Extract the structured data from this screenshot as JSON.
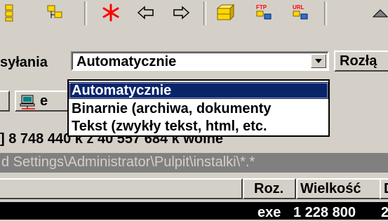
{
  "transfer": {
    "mode_label": "syłania",
    "mode_value": "Automatycznie",
    "split_button": "Rozłą",
    "options": [
      "Automatycznie",
      "Binarnie (archiwa, dokumenty",
      "Tekst (zwykły tekst, html, etc."
    ],
    "selected_index": 0
  },
  "row2": {
    "drive_button_label": "e"
  },
  "drive": {
    "space_text": "] 8 748 440 k z 40 557 684 k wolne"
  },
  "path": {
    "text": "d Settings\\Administrator\\Pulpit\\instalki\\*.*"
  },
  "columns": {
    "ext": "Roz.",
    "size": "Wielkość",
    "date": "D"
  },
  "file_row": {
    "ext": "exe",
    "size": "1 228 800",
    "date": "2"
  },
  "colors": {
    "window_bg": "#d4d0c8",
    "selection": "#0a246a",
    "path_bar": "#808080",
    "star_red": "#ff0000"
  }
}
